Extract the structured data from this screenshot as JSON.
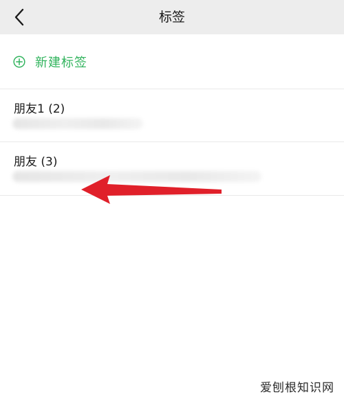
{
  "header": {
    "title": "标签",
    "back_icon": "chevron-left-icon"
  },
  "new_tag": {
    "label": "新建标签",
    "icon": "plus-circle-icon",
    "color": "#32b45e"
  },
  "tags": [
    {
      "name": "朋友1 (2)"
    },
    {
      "name": "朋友 (3)"
    }
  ],
  "annotation": {
    "arrow_color": "#e0202a"
  },
  "watermark": "爱刨根知识网"
}
